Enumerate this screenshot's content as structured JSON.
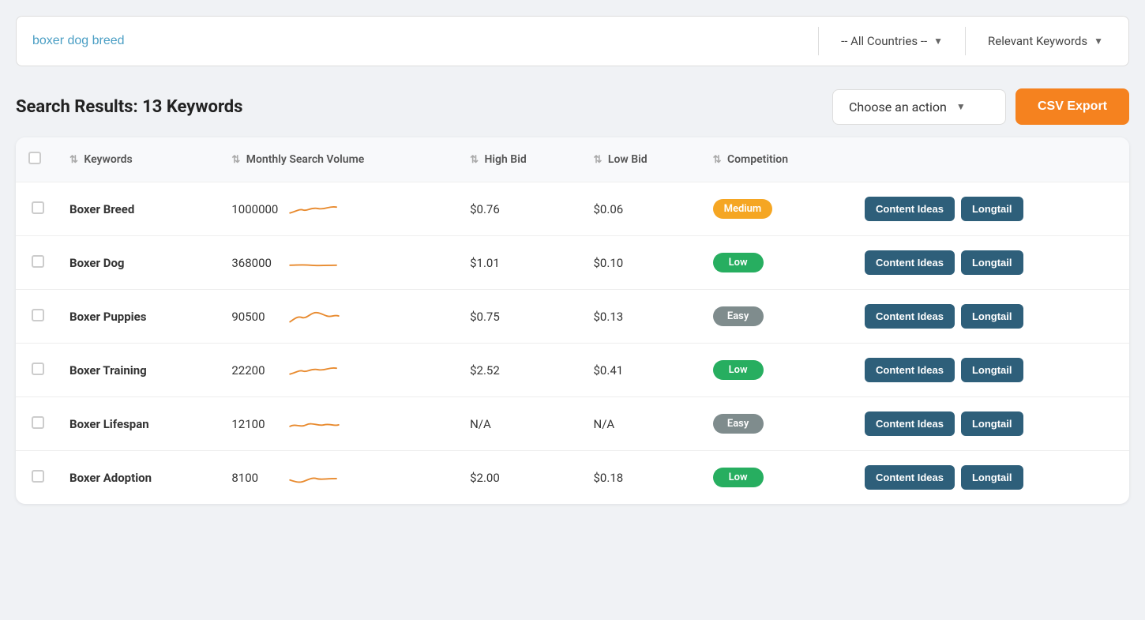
{
  "search": {
    "query": "boxer dog breed",
    "placeholder": "boxer dog breed",
    "country": "-- All Countries --",
    "keyword_type": "Relevant Keywords"
  },
  "results": {
    "title": "Search Results: 13 Keywords",
    "action_placeholder": "Choose an action",
    "csv_export_label": "CSV Export"
  },
  "table": {
    "columns": [
      {
        "label": "Keywords",
        "key": "keywords"
      },
      {
        "label": "Monthly Search Volume",
        "key": "volume"
      },
      {
        "label": "High Bid",
        "key": "high_bid"
      },
      {
        "label": "Low Bid",
        "key": "low_bid"
      },
      {
        "label": "Competition",
        "key": "competition"
      },
      {
        "label": "",
        "key": "actions"
      }
    ],
    "rows": [
      {
        "keyword": "Boxer Breed",
        "volume": "1000000",
        "high_bid": "$0.76",
        "low_bid": "$0.06",
        "competition": "Medium",
        "competition_class": "medium",
        "sparkline_type": "slight_wave"
      },
      {
        "keyword": "Boxer Dog",
        "volume": "368000",
        "high_bid": "$1.01",
        "low_bid": "$0.10",
        "competition": "Low",
        "competition_class": "low",
        "sparkline_type": "flat"
      },
      {
        "keyword": "Boxer Puppies",
        "volume": "90500",
        "high_bid": "$0.75",
        "low_bid": "$0.13",
        "competition": "Easy",
        "competition_class": "easy",
        "sparkline_type": "wave"
      },
      {
        "keyword": "Boxer Training",
        "volume": "22200",
        "high_bid": "$2.52",
        "low_bid": "$0.41",
        "competition": "Low",
        "competition_class": "low",
        "sparkline_type": "slight_wave"
      },
      {
        "keyword": "Boxer Lifespan",
        "volume": "12100",
        "high_bid": "N/A",
        "low_bid": "N/A",
        "competition": "Easy",
        "competition_class": "easy",
        "sparkline_type": "small_wave"
      },
      {
        "keyword": "Boxer Adoption",
        "volume": "8100",
        "high_bid": "$2.00",
        "low_bid": "$0.18",
        "competition": "Low",
        "competition_class": "low",
        "sparkline_type": "small_dip"
      }
    ],
    "content_ideas_label": "Content Ideas",
    "longtail_label": "Longtail"
  }
}
